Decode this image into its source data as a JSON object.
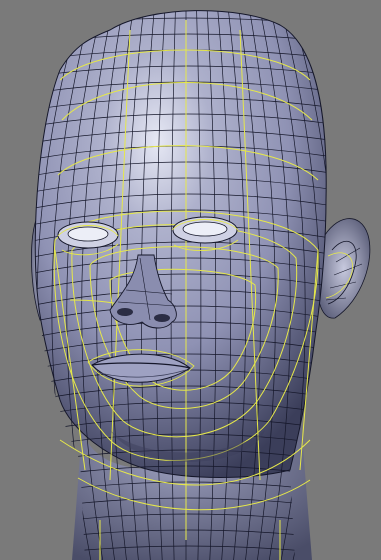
{
  "viewport": {
    "background_color": "#7a7a7a"
  },
  "model": {
    "kind": "head-mesh",
    "surface_color": "#8f92b4",
    "highlight_color": "#e6e8f4",
    "shadow_color": "#3b3e5a",
    "wire_color": "#15172a",
    "selected_loop_color": "#e6e84a"
  }
}
